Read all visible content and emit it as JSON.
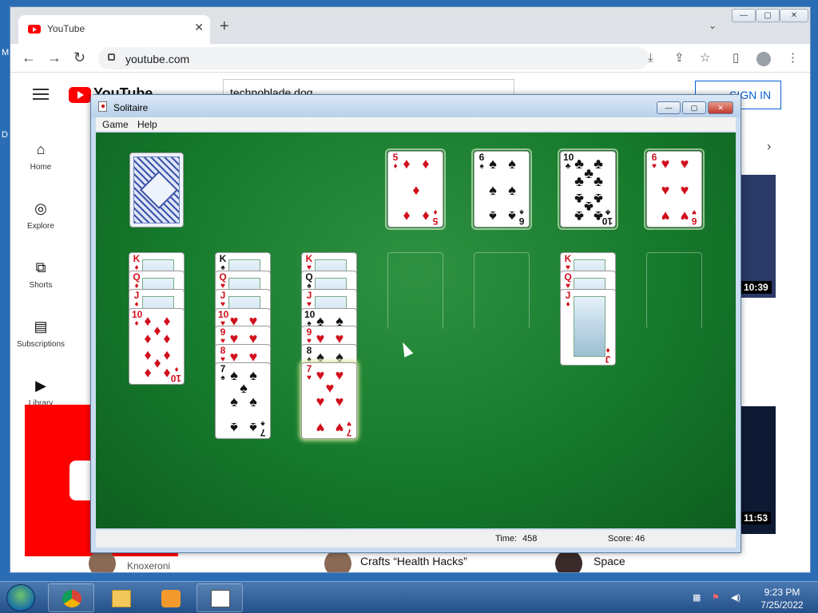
{
  "desktop": {
    "letter_m": "M",
    "letter_d": "D"
  },
  "browser": {
    "tab_title": "YouTube",
    "tab_close": "✕",
    "new_tab": "+",
    "tab_dropdown": "⌄",
    "url": "youtube.com",
    "window_buttons": {
      "minimize": "—",
      "maximize": "▢",
      "close": "✕"
    }
  },
  "youtube": {
    "logo_word": "YouTube",
    "search_query": "technoblade dog",
    "sign_in": "SIGN IN",
    "sidebar": [
      {
        "icon": "home-icon",
        "label": "Home"
      },
      {
        "icon": "explore-icon",
        "label": "Explore"
      },
      {
        "icon": "shorts-icon",
        "label": "Shorts"
      },
      {
        "icon": "subscriptions-icon",
        "label": "Subscriptions"
      },
      {
        "icon": "library-icon",
        "label": "Library"
      }
    ],
    "durations": [
      "10:39",
      "11:53"
    ],
    "videos": [
      {
        "channel": "Knoxeroni"
      },
      {
        "title": "Crafts “Health Hacks”"
      },
      {
        "title": "Space"
      }
    ]
  },
  "solitaire": {
    "title": "Solitaire",
    "menu": [
      "Game",
      "Help"
    ],
    "time_label": "Time:",
    "time_value": "458",
    "score_label": "Score:",
    "score_value": "46",
    "foundations": [
      {
        "rank": "5",
        "suit": "♦",
        "color": "red"
      },
      {
        "rank": "6",
        "suit": "♠",
        "color": "black"
      },
      {
        "rank": "10",
        "suit": "♣",
        "color": "black"
      },
      {
        "rank": "6",
        "suit": "♥",
        "color": "red"
      }
    ],
    "tableau": [
      {
        "cards": [
          {
            "rank": "K",
            "suit": "♦",
            "color": "red",
            "face": true
          },
          {
            "rank": "Q",
            "suit": "♦",
            "color": "red",
            "face": true
          },
          {
            "rank": "J",
            "suit": "♦",
            "color": "red",
            "face": true
          },
          {
            "rank": "10",
            "suit": "♦",
            "color": "red",
            "face": false
          }
        ]
      },
      {
        "cards": [
          {
            "rank": "K",
            "suit": "♠",
            "color": "black",
            "face": true
          },
          {
            "rank": "Q",
            "suit": "♥",
            "color": "red",
            "face": true
          },
          {
            "rank": "J",
            "suit": "♥",
            "color": "red",
            "face": true
          },
          {
            "rank": "10",
            "suit": "♥",
            "color": "red",
            "face": false
          },
          {
            "rank": "9",
            "suit": "♥",
            "color": "red",
            "face": false
          },
          {
            "rank": "8",
            "suit": "♥",
            "color": "red",
            "face": false
          },
          {
            "rank": "7",
            "suit": "♠",
            "color": "black",
            "face": false
          }
        ]
      },
      {
        "cards": [
          {
            "rank": "K",
            "suit": "♥",
            "color": "red",
            "face": true
          },
          {
            "rank": "Q",
            "suit": "♠",
            "color": "black",
            "face": true
          },
          {
            "rank": "J",
            "suit": "♥",
            "color": "red",
            "face": true
          },
          {
            "rank": "10",
            "suit": "♠",
            "color": "black",
            "face": false
          },
          {
            "rank": "9",
            "suit": "♥",
            "color": "red",
            "face": false
          },
          {
            "rank": "8",
            "suit": "♠",
            "color": "black",
            "face": false
          },
          {
            "rank": "7",
            "suit": "♥",
            "color": "red",
            "face": false
          }
        ]
      },
      {
        "cards": []
      },
      {
        "cards": []
      },
      {
        "cards": [
          {
            "rank": "K",
            "suit": "♥",
            "color": "red",
            "face": true
          },
          {
            "rank": "Q",
            "suit": "♥",
            "color": "red",
            "face": true
          },
          {
            "rank": "J",
            "suit": "♦",
            "color": "red",
            "face": true
          }
        ]
      },
      {
        "cards": []
      }
    ]
  },
  "taskbar": {
    "time": "9:23 PM",
    "date": "7/25/2022",
    "apps": [
      "chrome-icon",
      "explorer-icon",
      "media-player-icon",
      "solitaire-icon"
    ]
  }
}
